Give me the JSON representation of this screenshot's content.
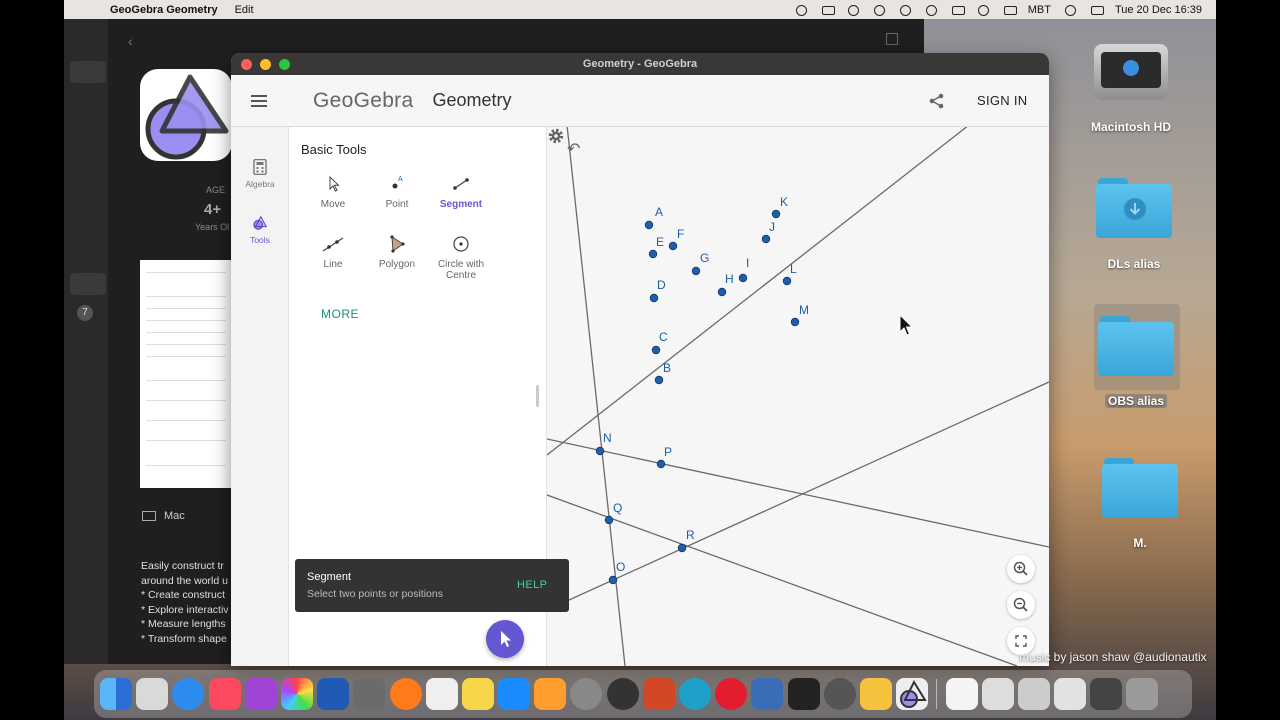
{
  "menubar": {
    "app_name": "GeoGebra Geometry",
    "menus": [
      "Edit"
    ],
    "status_text": "MBT",
    "clock": "Tue 20 Dec  16:39"
  },
  "store": {
    "age_label": "AGE",
    "age_value": "4+",
    "age_sub": "Years Ol",
    "sidebar_badge": "7",
    "platform": "Mac",
    "description": [
      "Easily construct tr",
      "around the world u",
      "",
      "* Create construct",
      "* Explore interactiv",
      "* Measure lengths",
      "* Transform shape"
    ]
  },
  "window": {
    "title": "Geometry - GeoGebra",
    "logo": "GeoGebra",
    "app_title": "Geometry",
    "sign_in": "SIGN IN",
    "rail": {
      "algebra": "Algebra",
      "tools": "Tools"
    },
    "tools_heading": "Basic Tools",
    "tools": [
      {
        "label": "Move",
        "icon": "move-icon",
        "selected": false
      },
      {
        "label": "Point",
        "icon": "point-icon",
        "selected": false
      },
      {
        "label": "Segment",
        "icon": "segment-icon",
        "selected": true
      },
      {
        "label": "Line",
        "icon": "line-icon",
        "selected": false
      },
      {
        "label": "Polygon",
        "icon": "polygon-icon",
        "selected": false
      },
      {
        "label": "Circle with Centre",
        "icon": "circle-with-centre-icon",
        "selected": false
      }
    ],
    "more": "MORE",
    "toast": {
      "title": "Segment",
      "subtitle": "Select two points or positions",
      "help": "HELP"
    },
    "points": [
      "A",
      "B",
      "C",
      "D",
      "E",
      "F",
      "G",
      "H",
      "I",
      "J",
      "K",
      "L",
      "M",
      "N",
      "P",
      "Q",
      "R",
      "O"
    ],
    "accent": "#6557d2"
  },
  "desktop": {
    "icons": [
      "Macintosh HD",
      "DLs alias",
      "OBS alias",
      "M."
    ],
    "caption": "music by jason shaw @audionautix"
  }
}
